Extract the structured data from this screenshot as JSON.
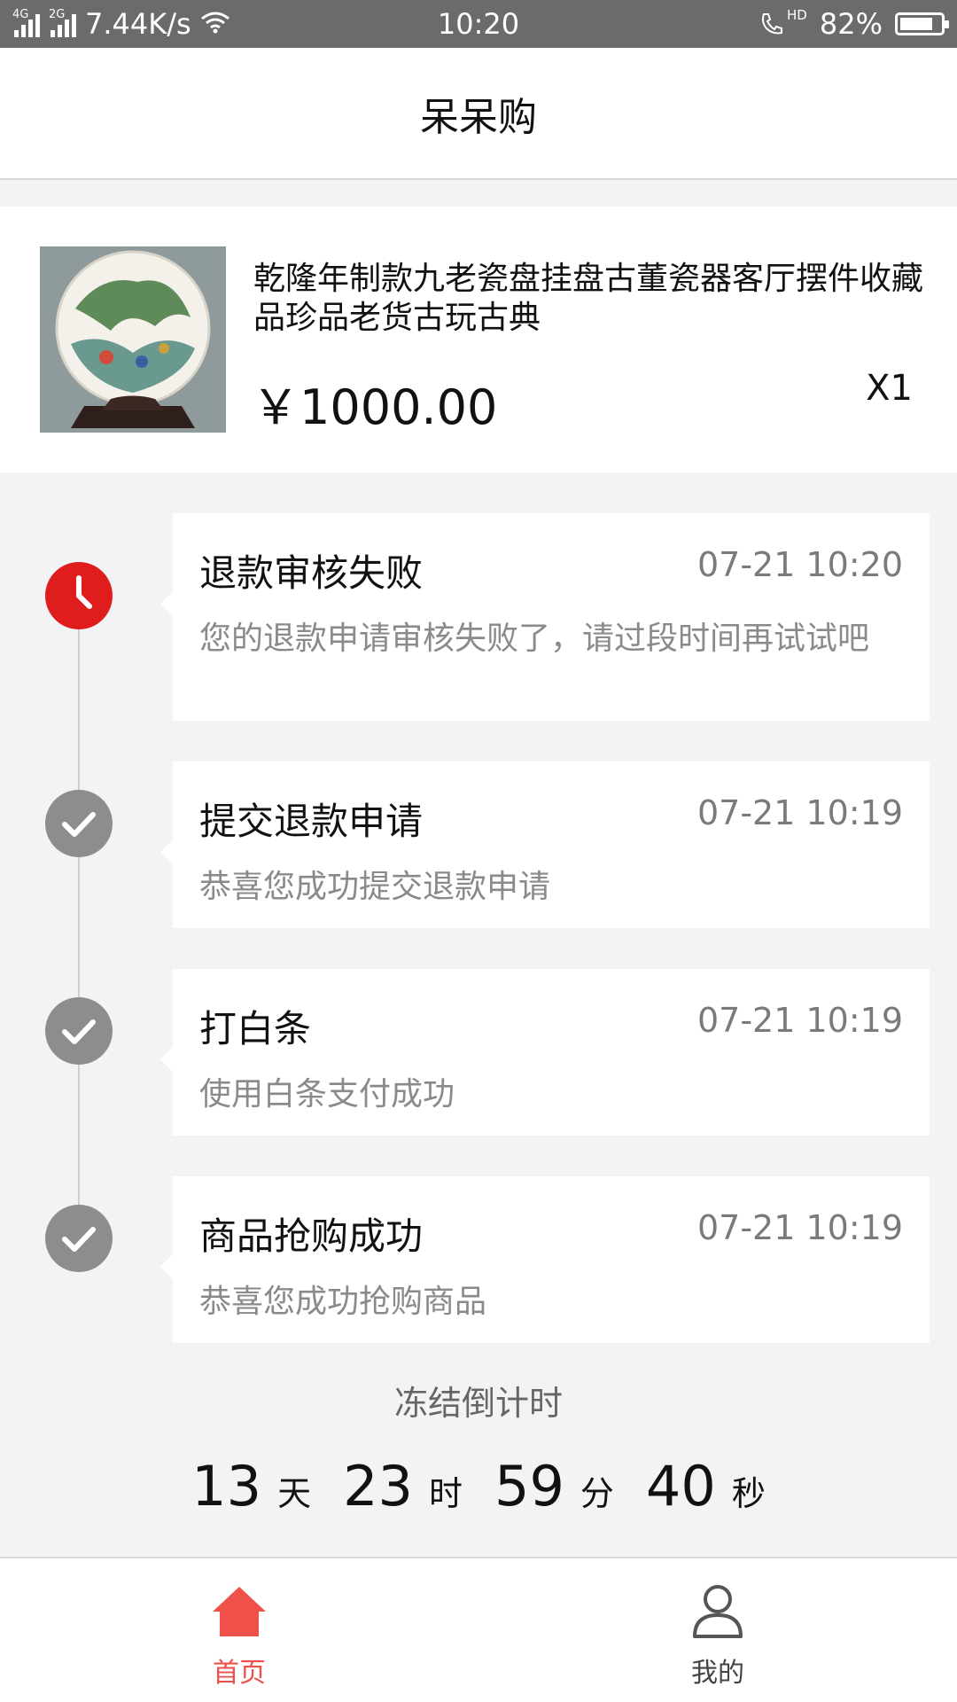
{
  "status_bar": {
    "net1": "4G",
    "net2": "2G",
    "speed": "7.44K/s",
    "time": "10:20",
    "hd": "HD",
    "battery": "82%",
    "battery_level": 0.82
  },
  "header": {
    "title": "呆呆购"
  },
  "product": {
    "name": "乾隆年制款九老瓷盘挂盘古董瓷器客厅摆件收藏品珍品老货古玩古典",
    "price": "￥1000.00",
    "quantity": "X1"
  },
  "timeline": [
    {
      "title": "退款审核失败",
      "time": "07-21 10:20",
      "desc": "您的退款申请审核失败了，请过段时间再试试吧",
      "icon": "clock-icon",
      "color": "#e01d1d"
    },
    {
      "title": "提交退款申请",
      "time": "07-21 10:19",
      "desc": "恭喜您成功提交退款申请",
      "icon": "check-icon",
      "color": "#8d8d8d"
    },
    {
      "title": "打白条",
      "time": "07-21 10:19",
      "desc": "使用白条支付成功",
      "icon": "check-icon",
      "color": "#8d8d8d"
    },
    {
      "title": "商品抢购成功",
      "time": "07-21 10:19",
      "desc": "恭喜您成功抢购商品",
      "icon": "check-icon",
      "color": "#8d8d8d"
    }
  ],
  "countdown": {
    "label": "冻结倒计时",
    "days": "13",
    "days_unit": "天",
    "hours": "23",
    "hours_unit": "时",
    "minutes": "59",
    "minutes_unit": "分",
    "seconds": "40",
    "seconds_unit": "秒"
  },
  "bottom_nav": {
    "home_label": "首页",
    "mine_label": "我的",
    "home_icon": "home-icon",
    "mine_icon": "user-icon",
    "active_color": "#f0504a"
  }
}
